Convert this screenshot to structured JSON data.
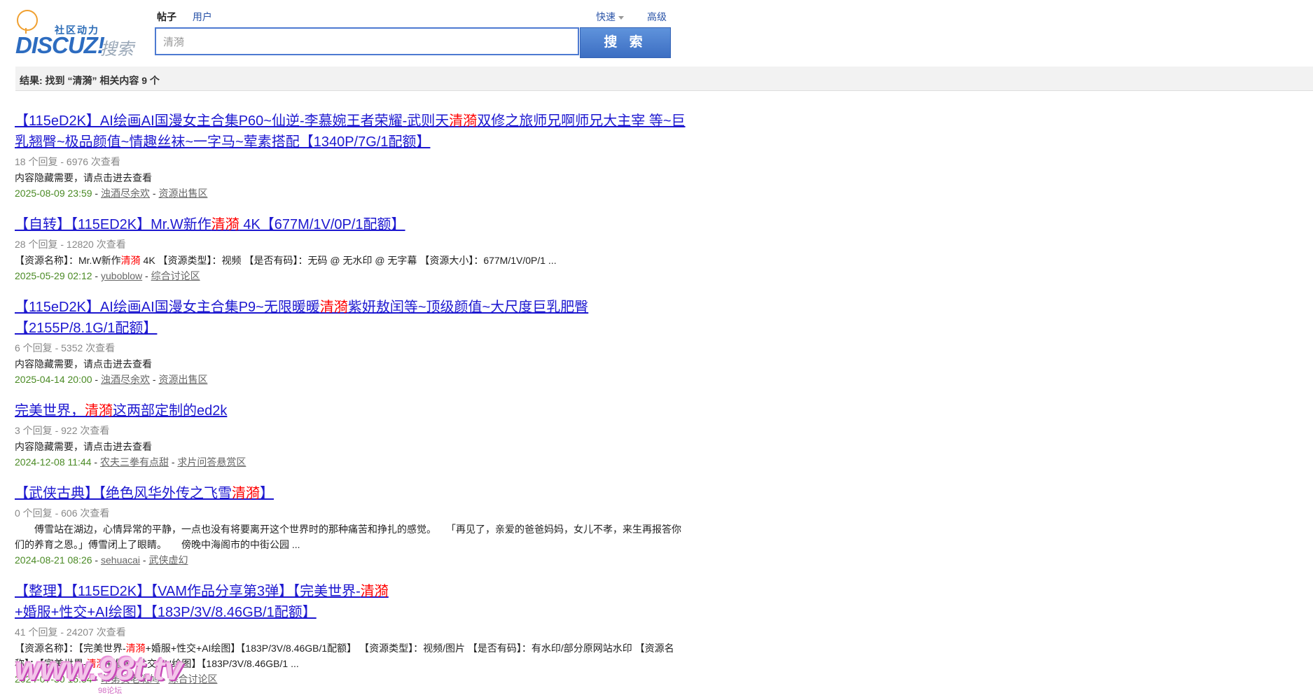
{
  "logo": {
    "tagline": "社区动力",
    "brand": "DISCUZ!",
    "search_word": "搜索"
  },
  "tabs": {
    "posts": "帖子",
    "users": "用户"
  },
  "quick_label": "快速",
  "advanced_label": "高级",
  "search": {
    "value": "清漪",
    "button": "搜 索"
  },
  "result_summary": "结果: 找到 “清漪” 相关内容 9 个",
  "results": [
    {
      "title_a": "【115eD2K】AI绘画AI国漫女主合集P60~仙逆-李慕婉王者荣耀-武则天",
      "title_hl": "清漪",
      "title_b": "双修之旅师兄啊师兄大主宰 等~巨乳翘臀~极品颜值~情趣丝袜~一字马~荤素搭配【1340P/7G/1配额】",
      "stat": "18 个回复 - 6976 次查看",
      "desc": "内容隐藏需要，请点击进去查看",
      "date": "2025-08-09 23:59",
      "author": "浊酒尽余欢",
      "forum": "资源出售区"
    },
    {
      "title_a": "【自转】【115ED2K】Mr.W新作",
      "title_hl": "清漪",
      "title_b": " 4K【677M/1V/0P/1配额】",
      "stat": "28 个回复 - 12820 次查看",
      "desc_a": "【资源名称】：Mr.W新作",
      "desc_hl": "清漪",
      "desc_b": " 4K 【资源类型】：视频 【是否有码】：无码 @ 无水印 @ 无字幕 【资源大小】：677M/1V/0P/1 ...",
      "date": "2025-05-29 02:12",
      "author": "yuboblow",
      "forum": "综合讨论区"
    },
    {
      "title_a": "【115eD2K】AI绘画AI国漫女主合集P9~无限暖暖",
      "title_hl": "清漪",
      "title_b": "紫妍敖闰等~顶级颜值~大尺度巨乳肥臀【2155P/8.1G/1配额】",
      "stat": "6 个回复 - 5352 次查看",
      "desc": "内容隐藏需要，请点击进去查看",
      "date": "2025-04-14 20:00",
      "author": "浊酒尽余欢",
      "forum": "资源出售区"
    },
    {
      "title_a": "完美世界，",
      "title_hl": "清漪",
      "title_b": "这两部定制的ed2k",
      "stat": "3 个回复 - 922 次查看",
      "desc": "内容隐藏需要，请点击进去查看",
      "date": "2024-12-08 11:44",
      "author": "农夫三拳有点甜",
      "forum": "求片问答悬赏区"
    },
    {
      "title_a": "【武侠古典】【绝色风华外传之飞雪",
      "title_hl": "清漪",
      "title_b": "】",
      "stat": "0 个回复 - 606 次查看",
      "desc": "　　傅雪站在湖边，心情异常的平静，一点也没有将要离开这个世界时的那种痛苦和挣扎的感觉。　　「再见了，亲爱的爸爸妈妈，女儿不孝，来生再报答你们的养育之恩。」傅雪闭上了眼睛。　　傍晚中海阁市的中街公园 ...",
      "date": "2024-08-21 08:26",
      "author": "sehuacai",
      "forum": "武侠虚幻"
    },
    {
      "title_a": "【整理】【115ED2K】【VAM作品分享第3弹】【完美世界-",
      "title_hl": "清漪",
      "title_b": "+婚服+性交+AI绘图】【183P/3V/8.46GB/1配额】",
      "stat": "41 个回复 - 24207 次查看",
      "desc_a": "【资源名称】：【完美世界-",
      "desc_hl": "清漪",
      "desc_b": "+婚服+性交+AI绘图】【183P/3V/8.46GB/1配额】 【资源类型】：视频/图片 【是否有码】：有水印/部分原网站水印 【资源名称】：【完美世界-",
      "desc_hl2": "清漪",
      "desc_c": "+婚服+性交+AI绘图】【183P/3V/8.46GB/1 ...",
      "date": "2024-07-30 15:54",
      "author": "印第安老斑鸠",
      "forum": "综合讨论区"
    }
  ],
  "watermark": {
    "text": "www.98t.tv",
    "sub": "98论坛"
  },
  "colors": {
    "link": "#1d18d0",
    "highlight": "#ff0000",
    "date": "#4a8a24",
    "button": "#4a7cc8"
  }
}
